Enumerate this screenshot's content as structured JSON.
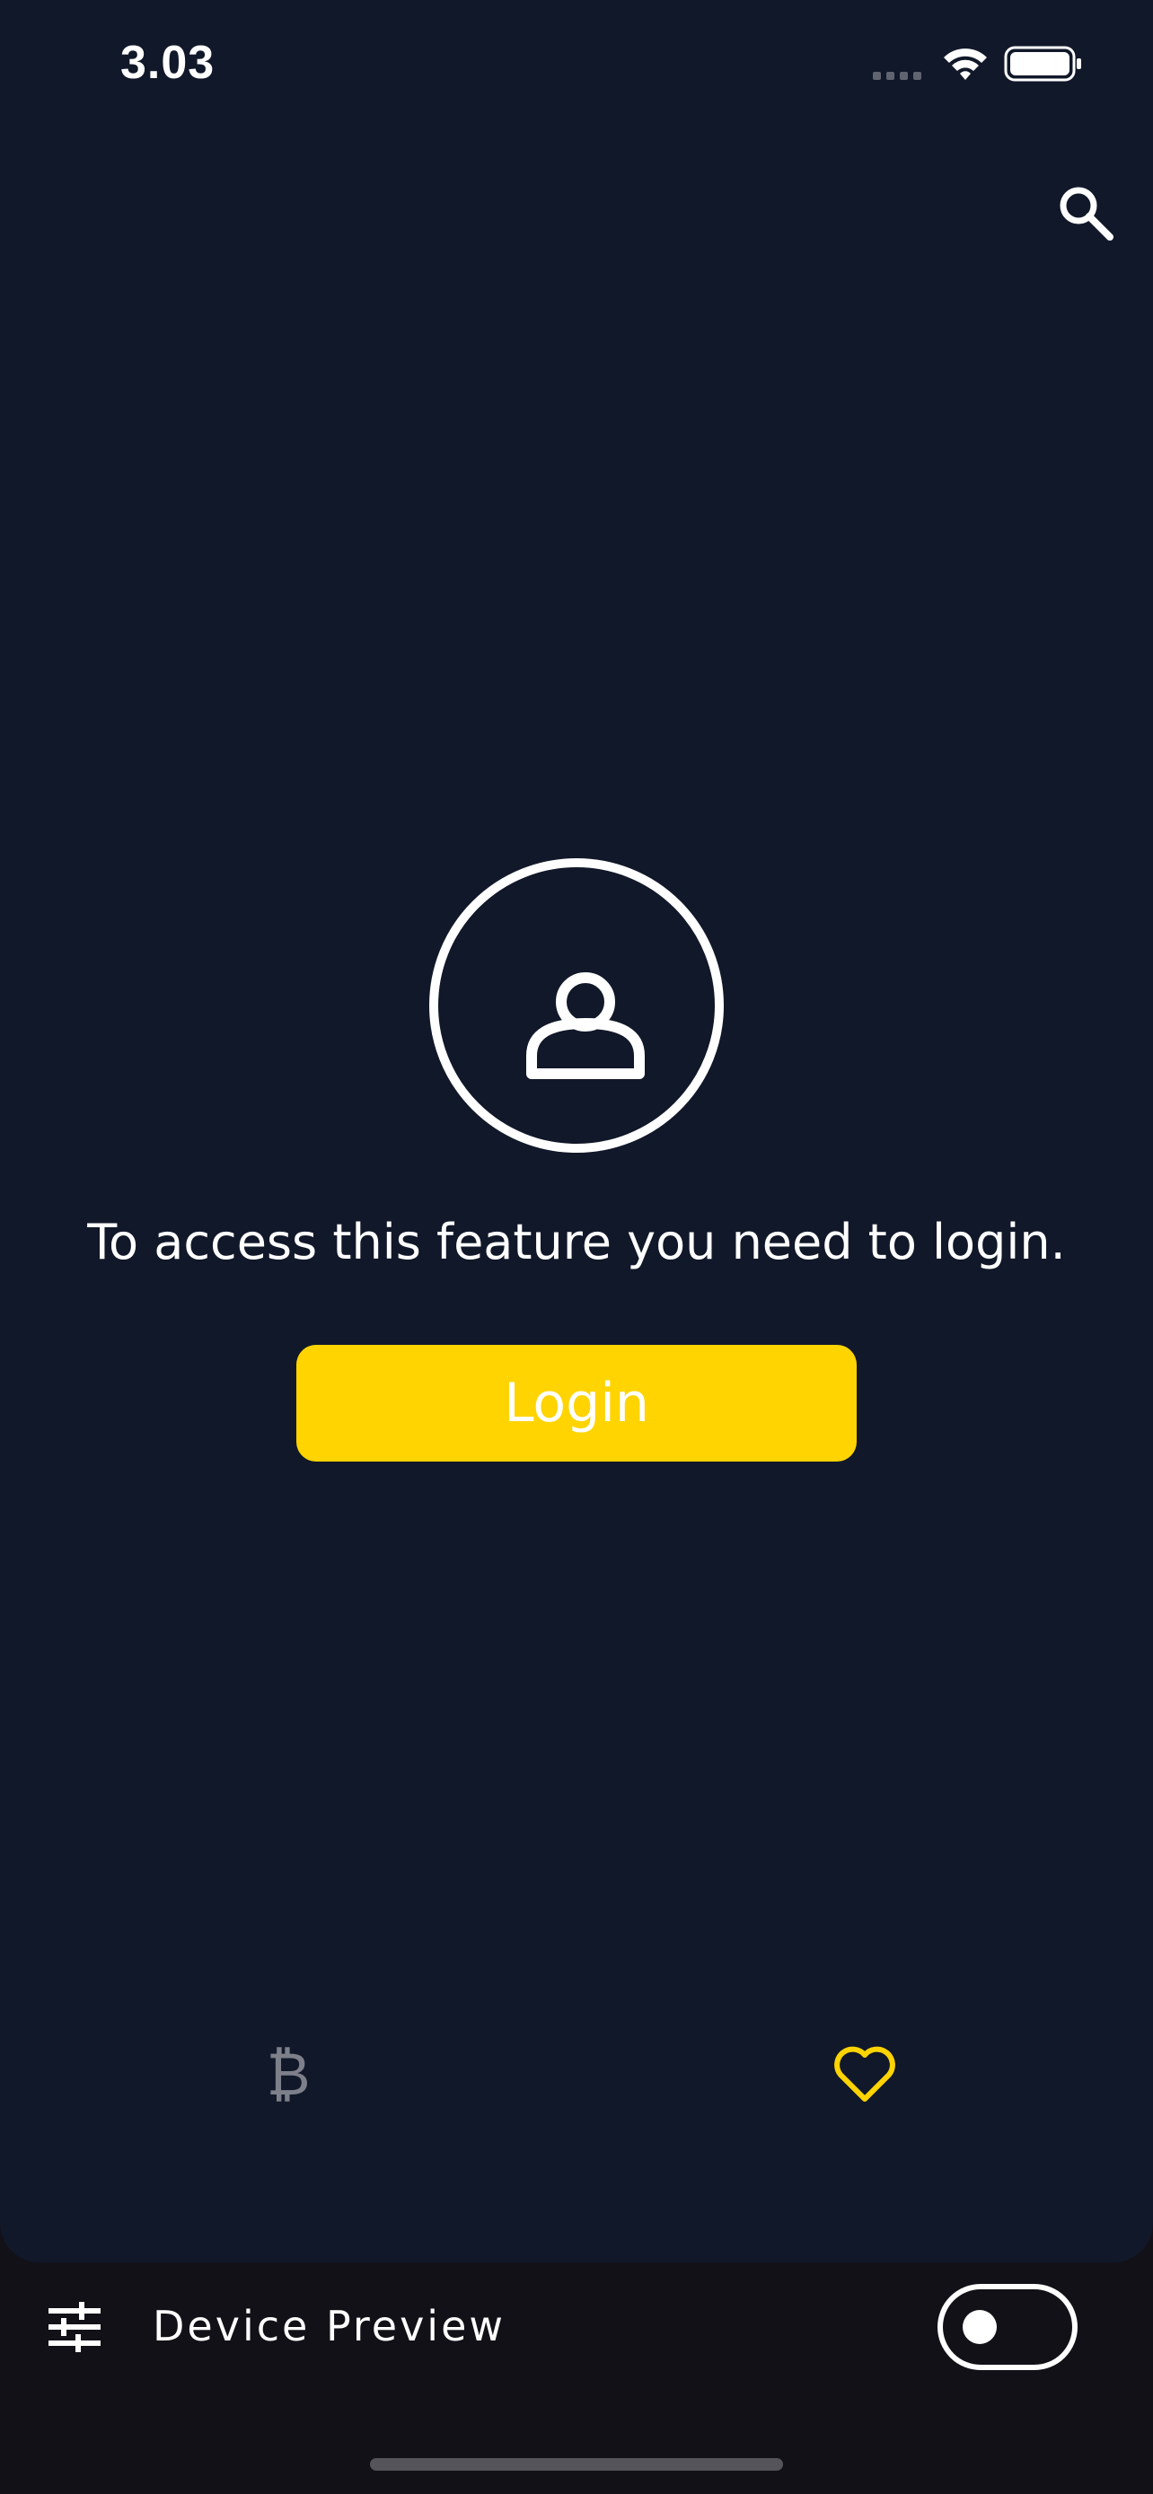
{
  "status_bar": {
    "time": "3.03",
    "wifi_icon": "wifi-icon",
    "battery_icon": "battery-icon"
  },
  "header": {
    "search_icon": "search-icon"
  },
  "main": {
    "avatar_icon": "person-icon",
    "message": "To access this feature you need to login.",
    "login_label": "Login"
  },
  "bottom_nav": {
    "items": [
      {
        "icon": "bitcoin-icon",
        "glyph": "₿",
        "active": false
      },
      {
        "icon": "heart-icon",
        "active": true
      }
    ]
  },
  "device_preview": {
    "label": "Device Preview",
    "toggle_on": false
  },
  "colors": {
    "background": "#111829",
    "accent": "#ffd400",
    "inactive_icon": "#7d808a",
    "preview_bar": "#131118"
  }
}
